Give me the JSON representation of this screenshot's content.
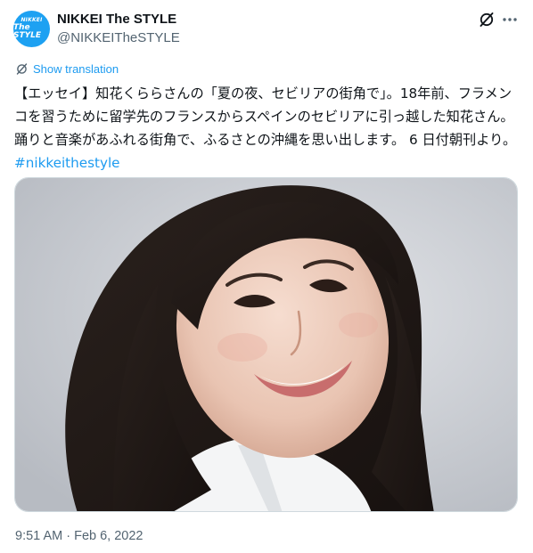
{
  "account": {
    "display_name": "NIKKEI The STYLE",
    "handle": "@NIKKEITheSTYLE",
    "avatar_line1": "NIKKEI",
    "avatar_line2": "The STYLE",
    "avatar_color": "#1da1f2"
  },
  "actions": {
    "grok_icon": "grok-slash-icon",
    "more_icon": "more-horizontal-icon"
  },
  "translation": {
    "label": "Show translation",
    "icon": "globe-slash-icon"
  },
  "post": {
    "text": "【エッセイ】知花くららさんの「夏の夜、セビリアの街角で」。18年前、フラメンコを習うために留学先のフランスからスペインのセビリアに引っ越した知花さん。踊りと音楽があふれる街角で、ふるさとの沖縄を思い出します。 6 日付朝刊より。 ",
    "hashtag": "#nikkeithestyle",
    "link_color": "#1d9bf0"
  },
  "media": {
    "alt": "Portrait photo of a smiling woman with long dark hair in a white shirt"
  },
  "meta": {
    "timestamp": "9:51 AM · Feb 6, 2022"
  }
}
